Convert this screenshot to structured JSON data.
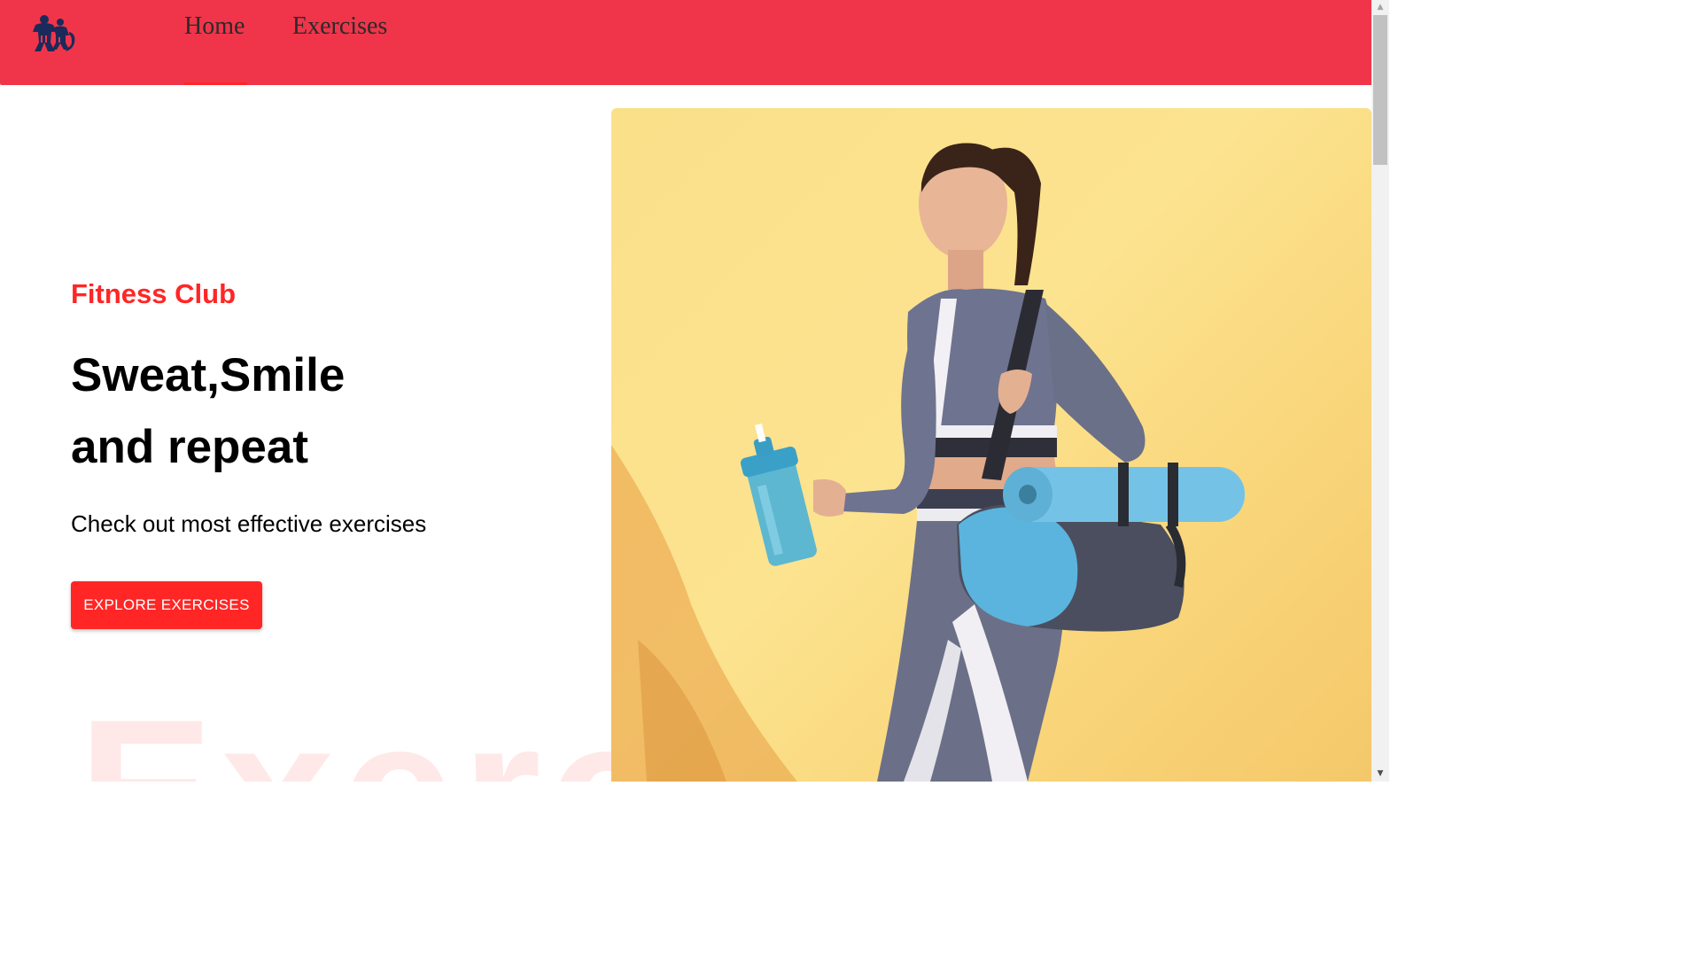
{
  "navbar": {
    "logo_icon": "gym-logo-icon",
    "links": [
      {
        "label": "Home",
        "active": true
      },
      {
        "label": "Exercises",
        "active": false
      }
    ]
  },
  "hero": {
    "subtitle": "Fitness Club",
    "title_line1": "Sweat,Smile",
    "title_line2": "and repeat",
    "description": "Check out most effective exercises",
    "button_label": "EXPLORE EXERCISES",
    "background_word": "Exercise"
  },
  "colors": {
    "navbar_bg": "#f0354a",
    "accent": "#ff2625",
    "image_bg": "#fce38f"
  },
  "scrollbar": {
    "up_icon": "scroll-up-arrow-icon",
    "down_icon": "scroll-down-arrow-icon"
  }
}
